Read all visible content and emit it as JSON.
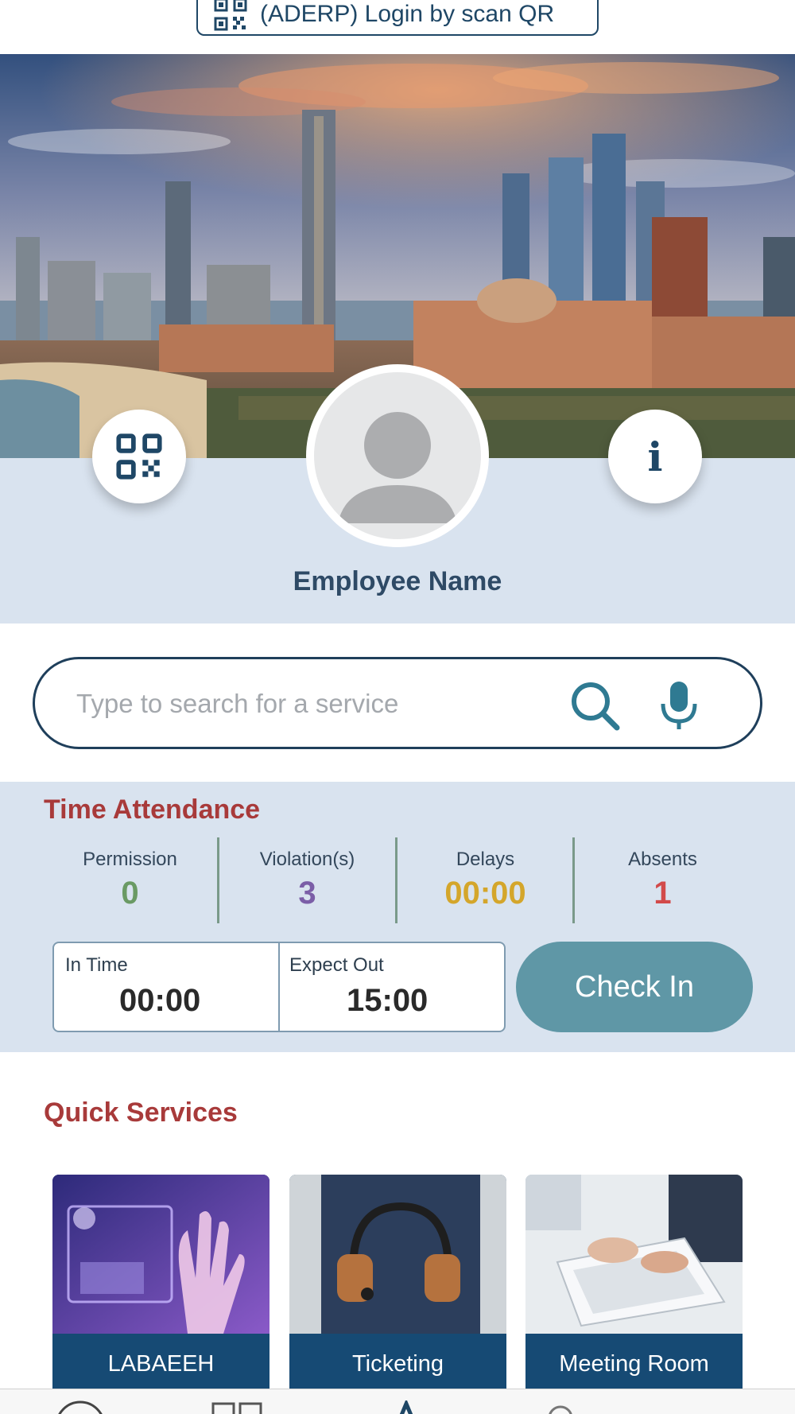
{
  "top_bar": {
    "login_qr_label": "(ADERP) Login by scan QR"
  },
  "profile": {
    "employee_name": "Employee Name"
  },
  "search": {
    "placeholder": "Type to search for a service"
  },
  "time_attendance": {
    "title": "Time Attendance",
    "stats": [
      {
        "label": "Permission",
        "value": "0",
        "color": "#6a9a64"
      },
      {
        "label": "Violation(s)",
        "value": "3",
        "color": "#7b5ea7"
      },
      {
        "label": "Delays",
        "value": "00:00",
        "color": "#d4a62b"
      },
      {
        "label": "Absents",
        "value": "1",
        "color": "#d24a4a"
      }
    ],
    "in_time_label": "In Time",
    "in_time_value": "00:00",
    "expect_out_label": "Expect Out",
    "expect_out_value": "15:00",
    "check_in_label": "Check In"
  },
  "quick_services": {
    "title": "Quick Services",
    "cards": [
      {
        "label": "LABAEEH",
        "image": "touchscreen-hand-photo"
      },
      {
        "label": "Ticketing",
        "image": "headset-person-photo"
      },
      {
        "label": "Meeting Room",
        "image": "laptop-meeting-photo"
      }
    ]
  },
  "tab_bar": {
    "icons": [
      "home-icon",
      "grid-icon",
      "services-icon",
      "profile-icon"
    ]
  },
  "colors": {
    "primary_navy": "#1f4766",
    "section_title_red": "#a83a3a",
    "band_blue": "#d9e3ef",
    "check_in_teal": "#5f97a6",
    "card_label_navy": "#164a74"
  }
}
